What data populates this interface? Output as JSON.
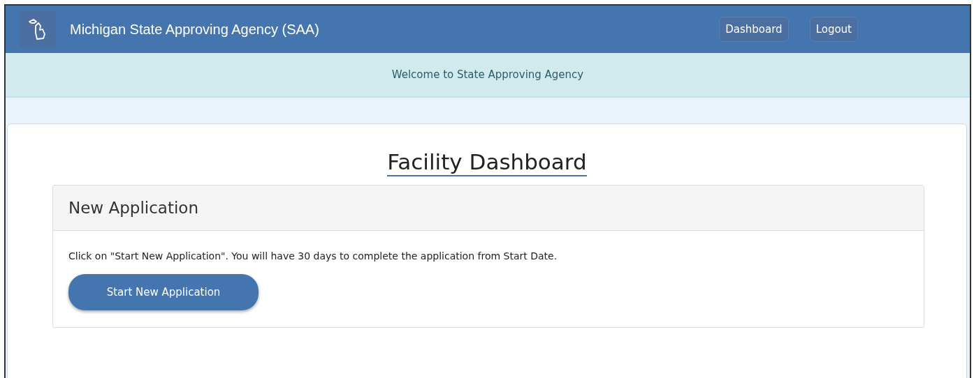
{
  "navbar": {
    "brand": "Michigan State Approving Agency (SAA)",
    "links": [
      {
        "label": "Dashboard"
      },
      {
        "label": "Logout"
      }
    ]
  },
  "welcome": "Welcome to State Approving Agency",
  "page_title": "Facility Dashboard",
  "panel": {
    "heading": "New Application",
    "text": "Click on \"Start New Application\". You will have 30 days to complete the application from Start Date.",
    "button": "Start New Application"
  }
}
